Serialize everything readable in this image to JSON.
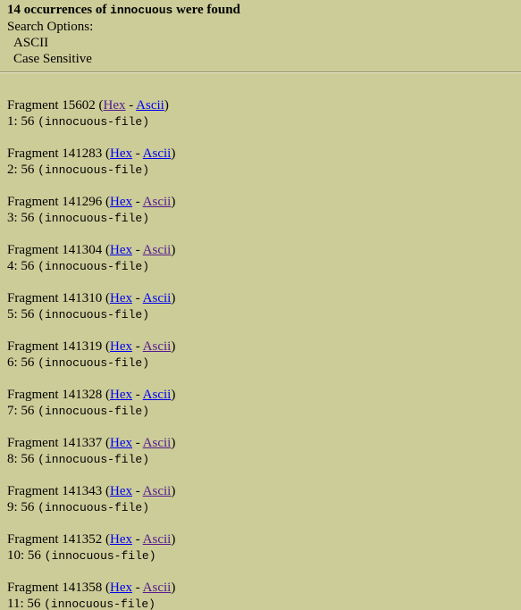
{
  "summary": {
    "count_text": "14 occurrences of",
    "term": "innocuous",
    "suffix": "were found"
  },
  "search_options": {
    "label": "Search Options:",
    "options": [
      "ASCII",
      "Case Sensitive"
    ]
  },
  "colors": {
    "background": "#CCCC99",
    "link_unvisited": "#0000EE",
    "link_visited": "#551A8B"
  },
  "results": [
    {
      "fragment_label": "Fragment 15602",
      "hex_label": "Hex",
      "ascii_label": "Ascii",
      "hex_visited": true,
      "ascii_visited": false,
      "hit": "1: 56",
      "file": "(innocuous-file)"
    },
    {
      "fragment_label": "Fragment 141283",
      "hex_label": "Hex",
      "ascii_label": "Ascii",
      "hex_visited": false,
      "ascii_visited": false,
      "hit": "2: 56",
      "file": "(innocuous-file)"
    },
    {
      "fragment_label": "Fragment 141296",
      "hex_label": "Hex",
      "ascii_label": "Ascii",
      "hex_visited": false,
      "ascii_visited": true,
      "hit": "3: 56",
      "file": "(innocuous-file)"
    },
    {
      "fragment_label": "Fragment 141304",
      "hex_label": "Hex",
      "ascii_label": "Ascii",
      "hex_visited": false,
      "ascii_visited": true,
      "hit": "4: 56",
      "file": "(innocuous-file)"
    },
    {
      "fragment_label": "Fragment 141310",
      "hex_label": "Hex",
      "ascii_label": "Ascii",
      "hex_visited": false,
      "ascii_visited": false,
      "hit": "5: 56",
      "file": "(innocuous-file)"
    },
    {
      "fragment_label": "Fragment 141319",
      "hex_label": "Hex",
      "ascii_label": "Ascii",
      "hex_visited": false,
      "ascii_visited": true,
      "hit": "6: 56",
      "file": "(innocuous-file)"
    },
    {
      "fragment_label": "Fragment 141328",
      "hex_label": "Hex",
      "ascii_label": "Ascii",
      "hex_visited": false,
      "ascii_visited": false,
      "hit": "7: 56",
      "file": "(innocuous-file)"
    },
    {
      "fragment_label": "Fragment 141337",
      "hex_label": "Hex",
      "ascii_label": "Ascii",
      "hex_visited": false,
      "ascii_visited": true,
      "hit": "8: 56",
      "file": "(innocuous-file)"
    },
    {
      "fragment_label": "Fragment 141343",
      "hex_label": "Hex",
      "ascii_label": "Ascii",
      "hex_visited": false,
      "ascii_visited": true,
      "hit": "9: 56",
      "file": "(innocuous-file)"
    },
    {
      "fragment_label": "Fragment 141352",
      "hex_label": "Hex",
      "ascii_label": "Ascii",
      "hex_visited": false,
      "ascii_visited": true,
      "hit": "10: 56",
      "file": "(innocuous-file)"
    },
    {
      "fragment_label": "Fragment 141358",
      "hex_label": "Hex",
      "ascii_label": "Ascii",
      "hex_visited": false,
      "ascii_visited": true,
      "hit": "11: 56",
      "file": "(innocuous-file)"
    }
  ]
}
